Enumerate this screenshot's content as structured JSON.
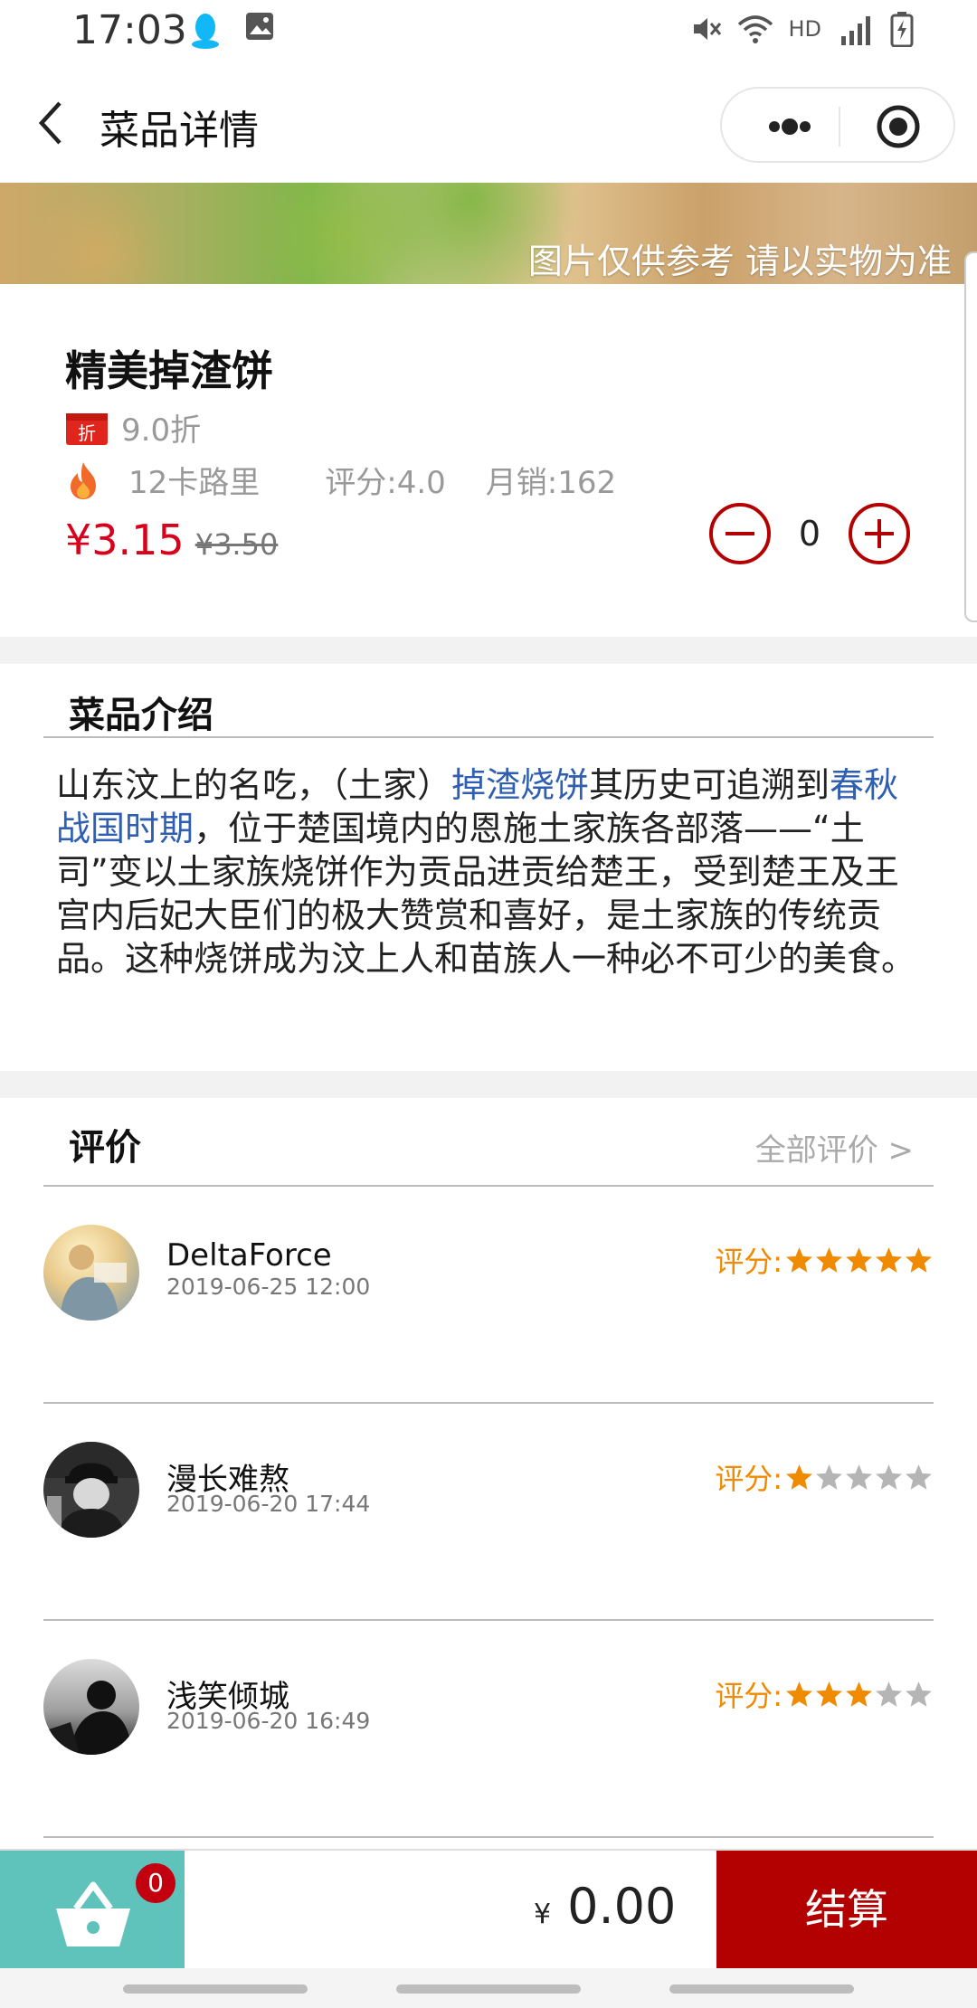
{
  "status_bar": {
    "time": "17:03",
    "network": "HD",
    "signal": "4G"
  },
  "nav": {
    "title": "菜品详情"
  },
  "banner": {
    "note": "图片仅供参考 请以实物为准"
  },
  "product": {
    "name": "精美掉渣饼",
    "discount_badge": "折",
    "discount": "9.0折",
    "calories": "12卡路里",
    "rating": "评分:4.0",
    "monthly_sales": "月销:162",
    "price": "¥3.15",
    "original_price": "¥3.50",
    "quantity": "0"
  },
  "intro": {
    "title": "菜品介绍",
    "text_1": "山东汶上的名吃，（土家）",
    "link_1": "掉渣烧饼",
    "text_2": "其历史可追溯到",
    "link_2": "春秋战国时期",
    "text_3": "，位于楚国境内的恩施土家族各部落——“土司”变以土家族烧饼作为贡品进贡给楚王，受到楚王及王宫内后妃大臣们的极大赞赏和喜好，是土家族的传统贡品。这种烧饼成为汶上人和苗族人一种必不可少的美食。"
  },
  "reviews": {
    "title": "评价",
    "all_link": "全部评价 >",
    "score_label": "评分:",
    "items": [
      {
        "name": "DeltaForce",
        "date": "2019-06-25 12:00",
        "stars": 5
      },
      {
        "name": "漫长难熬",
        "date": "2019-06-20 17:44",
        "stars": 1
      },
      {
        "name": "浅笑倾城",
        "date": "2019-06-20 16:49",
        "stars": 3
      }
    ],
    "star_color_on": "#f08a00",
    "star_color_off": "#b5b5b5"
  },
  "cart": {
    "badge_count": "0",
    "currency": "¥",
    "total": "0.00",
    "checkout_label": "结算"
  },
  "colors": {
    "accent_red": "#d9001b",
    "checkout_red": "#b30000",
    "cart_teal": "#5fc2bb",
    "link_blue": "#2f5fb2"
  }
}
